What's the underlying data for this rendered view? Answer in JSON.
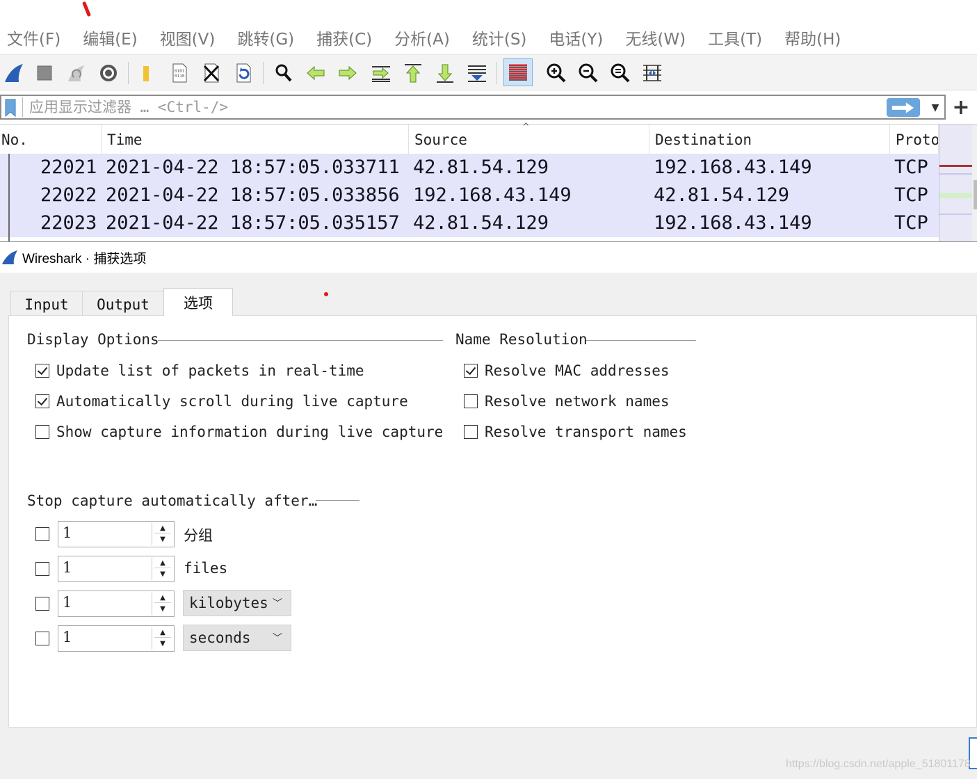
{
  "menu": [
    "文件(F)",
    "编辑(E)",
    "视图(V)",
    "跳转(G)",
    "捕获(C)",
    "分析(A)",
    "统计(S)",
    "电话(Y)",
    "无线(W)",
    "工具(T)",
    "帮助(H)"
  ],
  "toolbar": {
    "icons": [
      "shark-fin-icon",
      "stop-icon",
      "restart-icon",
      "options-gear-icon",
      "open-folder-icon",
      "save-file-icon",
      "close-file-icon",
      "reload-icon",
      "find-icon",
      "back-arrow-icon",
      "forward-arrow-icon",
      "go-to-packet-icon",
      "first-packet-icon",
      "last-packet-icon",
      "autoscroll-icon",
      "colorize-icon",
      "zoom-in-icon",
      "zoom-out-icon",
      "zoom-normal-icon",
      "resize-columns-icon"
    ],
    "active": "colorize-icon"
  },
  "filter": {
    "placeholder": "应用显示过滤器 … <Ctrl-/>",
    "value": "",
    "add_label": "+"
  },
  "packet_list": {
    "columns": [
      "No.",
      "Time",
      "Source",
      "Destination",
      "Proto"
    ],
    "sort_indicator": "^",
    "rows": [
      {
        "no": "22021",
        "time": "2021-04-22 18:57:05.033711",
        "source": "42.81.54.129",
        "destination": "192.168.43.149",
        "proto": "TCP"
      },
      {
        "no": "22022",
        "time": "2021-04-22 18:57:05.033856",
        "source": "192.168.43.149",
        "destination": "42.81.54.129",
        "proto": "TCP"
      },
      {
        "no": "22023",
        "time": "2021-04-22 18:57:05.035157",
        "source": "42.81.54.129",
        "destination": "192.168.43.149",
        "proto": "TCP"
      }
    ],
    "row_color": "#e4e4fb"
  },
  "dialog": {
    "title": "Wireshark · 捕获选项",
    "tabs": [
      "Input",
      "Output",
      "选项"
    ],
    "active_tab": "选项",
    "display_options": {
      "title": "Display Options",
      "items": [
        {
          "label": "Update list of packets in real-time",
          "checked": true
        },
        {
          "label": "Automatically scroll during live capture",
          "checked": true
        },
        {
          "label": "Show capture information during live capture",
          "checked": false
        }
      ]
    },
    "name_resolution": {
      "title": "Name Resolution",
      "items": [
        {
          "label": "Resolve MAC addresses",
          "checked": true
        },
        {
          "label": "Resolve network names",
          "checked": false
        },
        {
          "label": "Resolve transport names",
          "checked": false
        }
      ]
    },
    "stop_capture": {
      "title": "Stop capture automatically after…",
      "rows": [
        {
          "checked": false,
          "value": "1",
          "unit": "分组",
          "unit_type": "label"
        },
        {
          "checked": false,
          "value": "1",
          "unit": "files",
          "unit_type": "label"
        },
        {
          "checked": false,
          "value": "1",
          "unit": "kilobytes",
          "unit_type": "select"
        },
        {
          "checked": false,
          "value": "1",
          "unit": "seconds",
          "unit_type": "select"
        }
      ]
    }
  },
  "watermark": "https://blog.csdn.net/apple_51801178"
}
